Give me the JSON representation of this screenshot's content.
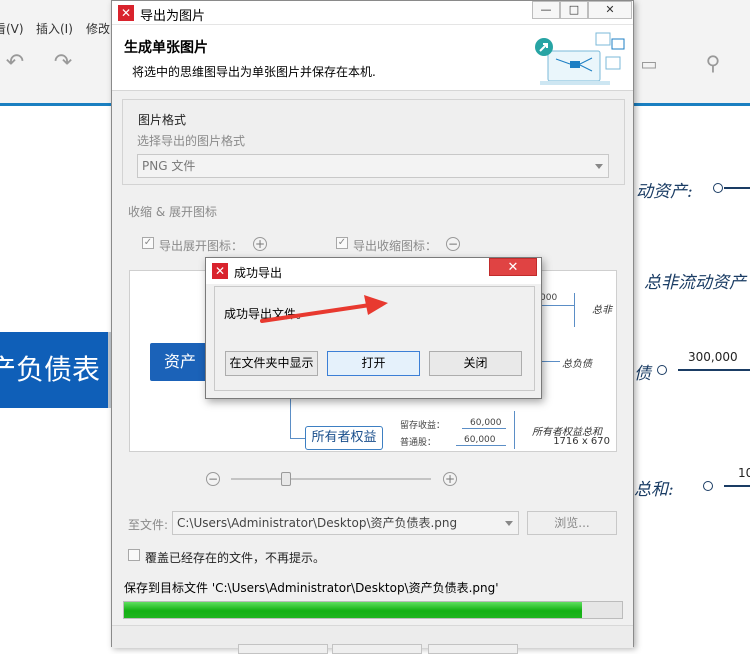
{
  "background_app": {
    "menu": [
      {
        "label": "看(V)"
      },
      {
        "label": "插入(I)"
      },
      {
        "label": "修改"
      }
    ],
    "central_node": "产负债表",
    "right_items": [
      {
        "text": "动资产:"
      },
      {
        "text": "总非流动资产"
      },
      {
        "text": "债"
      },
      {
        "text": "总和:"
      }
    ],
    "right_numbers": [
      "300,000",
      "10"
    ]
  },
  "dialog": {
    "title": "导出为图片",
    "header_title": "生成单张图片",
    "header_desc": "将选中的思维图导出为单张图片并保存在本机.",
    "format_group_label": "图片格式",
    "format_prompt": "选择导出的图片格式",
    "format_value": "PNG 文件",
    "icons_section_label": "收缩 & 展开图标",
    "export_expand_label": "导出展开图标：",
    "export_collapse_label": "导出收缩图标：",
    "preview": {
      "root": "资产",
      "owner_node": "所有者权益",
      "retained_label": "留存收益：",
      "retained_value": "60,000",
      "common_label": "普通股：",
      "common_value": "60,000",
      "equity_total_label": "所有者权益总和",
      "debt_label": "总负债",
      "noncurrent_label": "总非",
      "top_value": "000",
      "dimensions": "1716 x 670"
    },
    "save_to_label": "至文件:",
    "path_value": "C:\\Users\\Administrator\\Desktop\\资产负债表.png",
    "browse_label": "浏览...",
    "overwrite_label": "覆盖已经存在的文件，不再提示。",
    "status_text": "保存到目标文件 'C:\\Users\\Administrator\\Desktop\\资产负债表.png'",
    "progress_percent": 92
  },
  "modal": {
    "title": "成功导出",
    "message": "成功导出文件。",
    "btn_show_in_folder": "在文件夹中显示",
    "btn_open": "打开",
    "btn_close": "关闭"
  },
  "colors": {
    "accent_blue": "#1a7fc1",
    "node_blue": "#0f5fb8",
    "logo_red": "#d9232d",
    "close_red": "#e04343",
    "progress_green": "#13b013",
    "arrow_red": "#e8392f"
  }
}
